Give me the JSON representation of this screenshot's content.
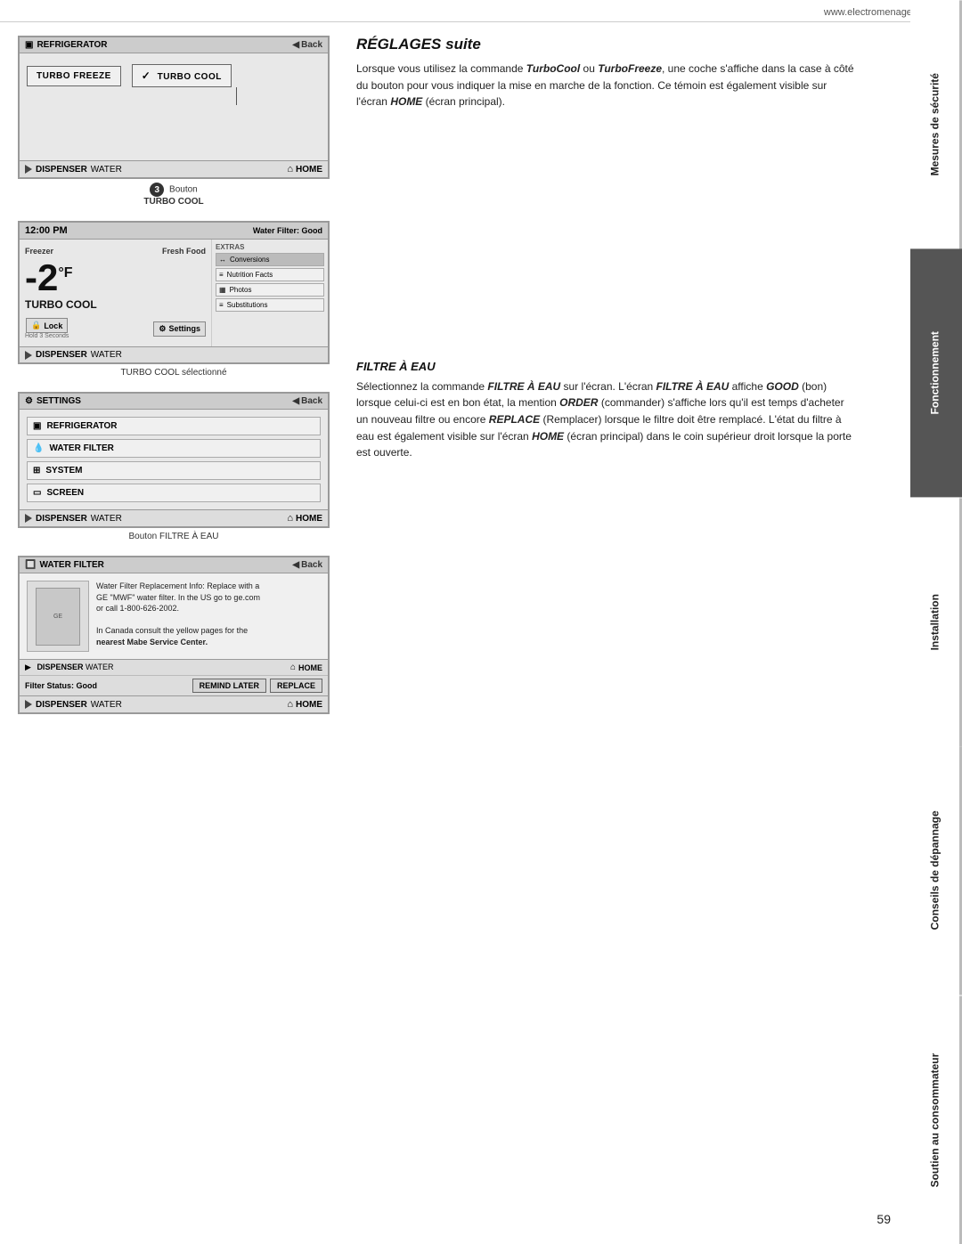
{
  "header": {
    "website": "www.electromenagersge.ca"
  },
  "sidebar": {
    "tabs": [
      {
        "id": "securite",
        "label": "Mesures de sécurité",
        "active": false,
        "dark": false
      },
      {
        "id": "fonctionnement",
        "label": "Fonctionnement",
        "active": true,
        "dark": false
      },
      {
        "id": "installation",
        "label": "Installation",
        "active": false,
        "dark": false
      },
      {
        "id": "conseils",
        "label": "Conseils de dépannage",
        "active": false,
        "dark": false
      },
      {
        "id": "soutien",
        "label": "Soutien au consommateur",
        "active": false,
        "dark": false
      }
    ]
  },
  "screen1": {
    "header_left": "Refrigerator",
    "header_right": "Back",
    "button1": "Turbo Freeze",
    "button2": "Turbo Cool",
    "footer_left_icon": "triangle",
    "footer_left": "Dispenser",
    "footer_left2": "Water",
    "footer_right_icon": "house",
    "footer_right": "Home"
  },
  "screen1_caption": {
    "number": "3",
    "line1": "Bouton",
    "line2": "TURBO COOL"
  },
  "screen2": {
    "header_left_time": "12:00 PM",
    "header_right": "Water Filter: Good",
    "freezer": "Freezer",
    "fresh_food": "Fresh Food",
    "temp": "-2",
    "temp_unit": "°F",
    "turbo_cool": "Turbo Cool",
    "lock": "Lock",
    "hold_text": "Hold 3 Seconds",
    "settings": "Settings",
    "extras_label": "Extras",
    "extras_items": [
      {
        "label": "Conversions",
        "selected": true
      },
      {
        "label": "Nutrition Facts",
        "selected": false
      },
      {
        "label": "Photos",
        "selected": false
      },
      {
        "label": "Substitutions",
        "selected": false
      }
    ],
    "footer_left_icon": "triangle",
    "footer_left": "Dispenser",
    "footer_left2": "Water"
  },
  "screen2_caption": "TURBO COOL sélectionné",
  "screen3": {
    "header_left": "Settings",
    "header_right": "Back",
    "items": [
      {
        "icon": "fridge",
        "label": "Refrigerator"
      },
      {
        "icon": "water",
        "label": "Water Filter"
      },
      {
        "icon": "system",
        "label": "System"
      },
      {
        "icon": "screen",
        "label": "Screen"
      }
    ],
    "footer_left_icon": "triangle",
    "footer_left": "Dispenser",
    "footer_left2": "Water",
    "footer_right_icon": "house",
    "footer_right": "Home"
  },
  "screen3_caption": "Bouton FILTRE À EAU",
  "screen4": {
    "header_left": "Water Filter",
    "header_right": "Back",
    "filter_text_line1": "Water Filter Replacement Info: Replace with a",
    "filter_text_line2": "GE \"MWF\" water filter. In the US go to ge.com",
    "filter_text_line3": "or call 1-800-626-2002.",
    "filter_text_line4": "",
    "filter_text_line5": "In Canada consult the yellow pages for the",
    "filter_text_line6": "nearest Mabe Service Center.",
    "filter_status": "Filter Status: Good",
    "btn_remind": "Remind Later",
    "btn_replace": "Replace",
    "footer_left_icon": "triangle",
    "footer_left": "Dispenser",
    "footer_left2": "Water",
    "footer_right_icon": "house",
    "footer_right": "Home"
  },
  "section_reglages": {
    "title": "RÉGLAGES suite",
    "body": "Lorsque vous utilisez la commande TurboCool ou TurboFreeze, une coche s'affiche dans la case à côté du bouton pour vous indiquer la mise en marche de la fonction. Ce témoin est également visible sur l'écran HOME (écran principal)."
  },
  "section_filtre": {
    "title": "FILTRE À EAU",
    "body1": "Sélectionnez la commande FILTRE À EAU sur l'écran. L'écran FILTRE À EAU affiche GOOD (bon) lorsque celui-ci est en bon état, la mention ORDER (commander) s'affiche lors qu'il est temps d'acheter un nouveau filtre ou encore REPLACE (Remplacer) lorsque le filtre doit être remplacé. L'état du filtre à eau est également visible sur l'écran HOME (écran principal) dans le coin supérieur droit lorsque la porte est ouverte."
  },
  "page_number": "59"
}
